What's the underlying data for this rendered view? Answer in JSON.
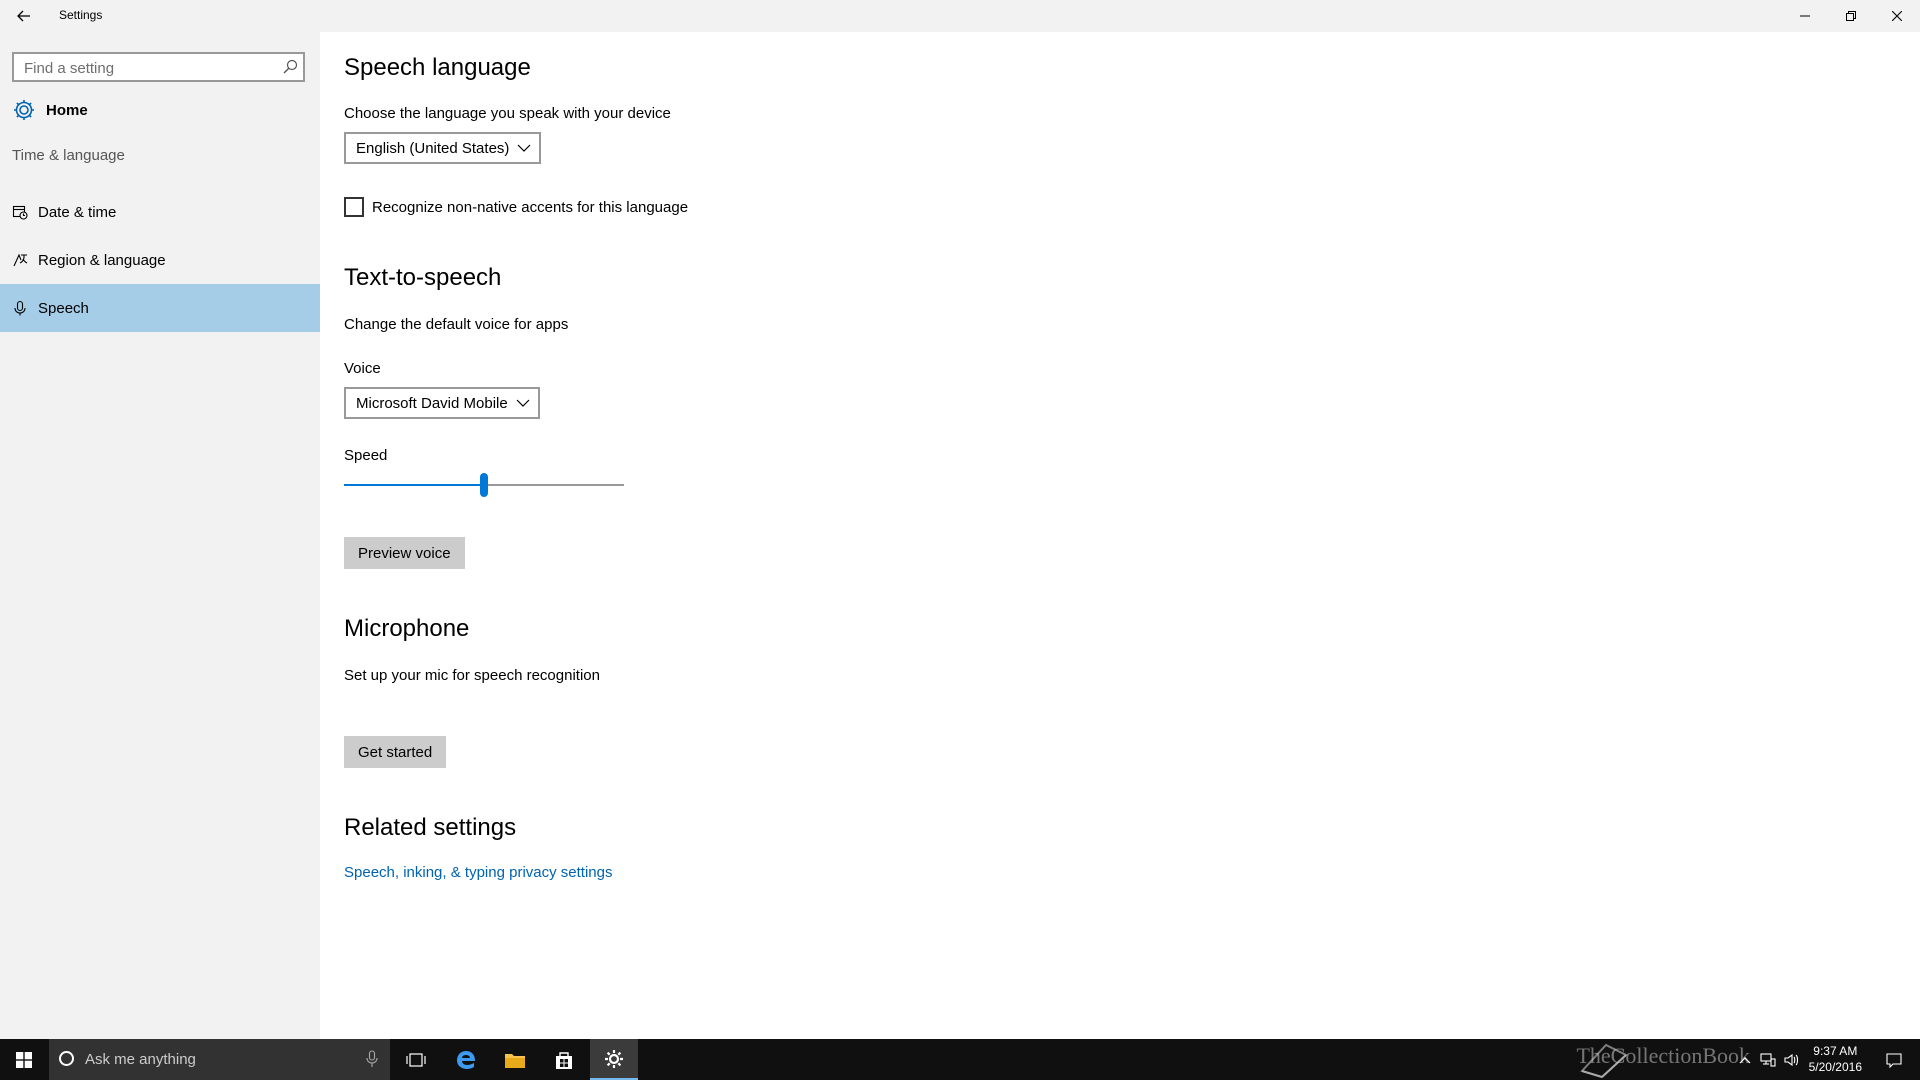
{
  "titlebar": {
    "title": "Settings"
  },
  "sidebar": {
    "search_placeholder": "Find a setting",
    "home_label": "Home",
    "section_label": "Time & language",
    "items": [
      {
        "label": "Date & time",
        "icon": "calendar-clock-icon"
      },
      {
        "label": "Region & language",
        "icon": "region-language-icon"
      },
      {
        "label": "Speech",
        "icon": "microphone-icon",
        "selected": true
      }
    ]
  },
  "speech_language": {
    "heading": "Speech language",
    "description": "Choose the language you speak with your device",
    "dropdown_value": "English (United States)",
    "checkbox_label": "Recognize non-native accents for this language",
    "checkbox_checked": false
  },
  "tts": {
    "heading": "Text-to-speech",
    "description": "Change the default voice for apps",
    "voice_label": "Voice",
    "voice_value": "Microsoft David Mobile",
    "speed_label": "Speed",
    "speed_level": 0.5,
    "preview_button": "Preview voice"
  },
  "microphone": {
    "heading": "Microphone",
    "description": "Set up your mic for speech recognition",
    "button": "Get started"
  },
  "related": {
    "heading": "Related settings",
    "link": "Speech, inking, & typing privacy settings"
  },
  "taskbar": {
    "search_placeholder": "Ask me anything",
    "time": "9:37 AM",
    "date": "5/20/2016",
    "watermark": "TheCollectionBook"
  },
  "colors": {
    "accent": "#0078d7",
    "selected_bg": "#a5cde7",
    "link": "#0063b1"
  }
}
